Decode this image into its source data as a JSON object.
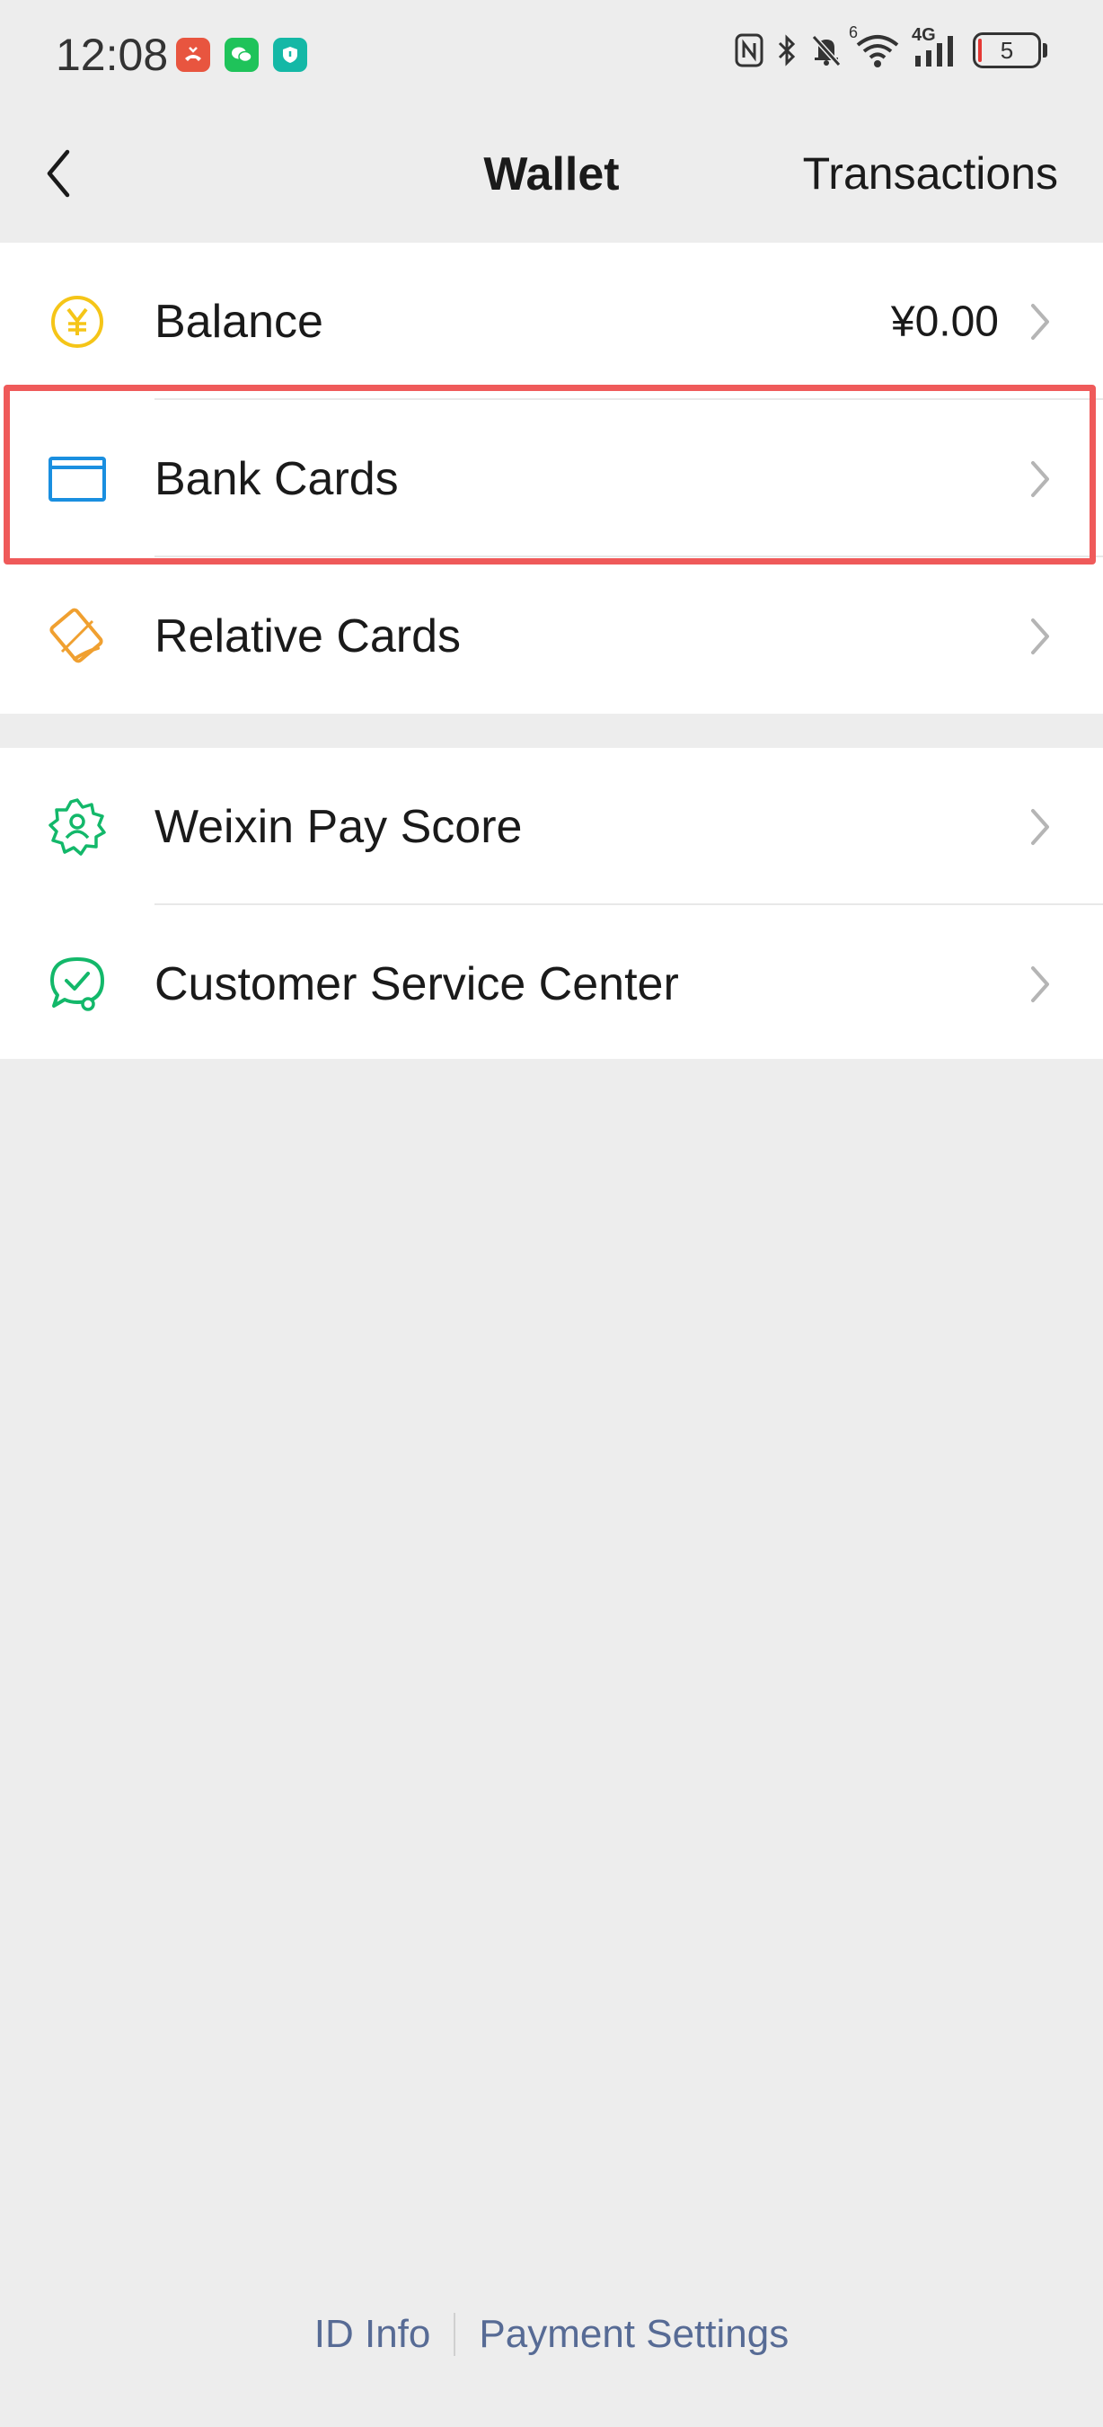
{
  "status_bar": {
    "time": "12:08",
    "battery": "5",
    "network": "4G",
    "wifi_badge": "6"
  },
  "nav": {
    "title": "Wallet",
    "action": "Transactions"
  },
  "groups": [
    {
      "items": [
        {
          "label": "Balance",
          "value": "¥0.00",
          "icon": "yuan-coin-icon"
        },
        {
          "label": "Bank Cards",
          "value": "",
          "icon": "bank-card-icon"
        },
        {
          "label": "Relative Cards",
          "value": "",
          "icon": "relative-cards-icon"
        }
      ]
    },
    {
      "items": [
        {
          "label": "Weixin Pay Score",
          "value": "",
          "icon": "pay-score-icon"
        },
        {
          "label": "Customer Service Center",
          "value": "",
          "icon": "customer-service-icon"
        }
      ]
    }
  ],
  "footer": {
    "id_info": "ID Info",
    "payment_settings": "Payment Settings"
  },
  "colors": {
    "background": "#ededed",
    "highlight": "#ef5a5a",
    "link": "#576b95",
    "balance_icon": "#f5c518",
    "bank_icon": "#1a8fe0",
    "relative_icon": "#f0a030",
    "green_icon": "#13b86a"
  }
}
